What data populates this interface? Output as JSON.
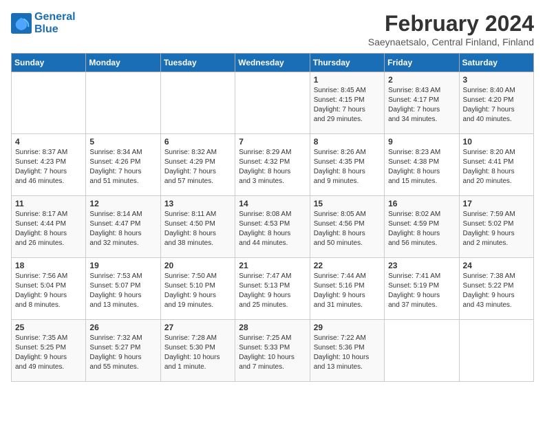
{
  "header": {
    "logo_line1": "General",
    "logo_line2": "Blue",
    "month_year": "February 2024",
    "location": "Saeynaetsalo, Central Finland, Finland"
  },
  "weekdays": [
    "Sunday",
    "Monday",
    "Tuesday",
    "Wednesday",
    "Thursday",
    "Friday",
    "Saturday"
  ],
  "weeks": [
    [
      {
        "day": "",
        "text": ""
      },
      {
        "day": "",
        "text": ""
      },
      {
        "day": "",
        "text": ""
      },
      {
        "day": "",
        "text": ""
      },
      {
        "day": "1",
        "text": "Sunrise: 8:45 AM\nSunset: 4:15 PM\nDaylight: 7 hours\nand 29 minutes."
      },
      {
        "day": "2",
        "text": "Sunrise: 8:43 AM\nSunset: 4:17 PM\nDaylight: 7 hours\nand 34 minutes."
      },
      {
        "day": "3",
        "text": "Sunrise: 8:40 AM\nSunset: 4:20 PM\nDaylight: 7 hours\nand 40 minutes."
      }
    ],
    [
      {
        "day": "4",
        "text": "Sunrise: 8:37 AM\nSunset: 4:23 PM\nDaylight: 7 hours\nand 46 minutes."
      },
      {
        "day": "5",
        "text": "Sunrise: 8:34 AM\nSunset: 4:26 PM\nDaylight: 7 hours\nand 51 minutes."
      },
      {
        "day": "6",
        "text": "Sunrise: 8:32 AM\nSunset: 4:29 PM\nDaylight: 7 hours\nand 57 minutes."
      },
      {
        "day": "7",
        "text": "Sunrise: 8:29 AM\nSunset: 4:32 PM\nDaylight: 8 hours\nand 3 minutes."
      },
      {
        "day": "8",
        "text": "Sunrise: 8:26 AM\nSunset: 4:35 PM\nDaylight: 8 hours\nand 9 minutes."
      },
      {
        "day": "9",
        "text": "Sunrise: 8:23 AM\nSunset: 4:38 PM\nDaylight: 8 hours\nand 15 minutes."
      },
      {
        "day": "10",
        "text": "Sunrise: 8:20 AM\nSunset: 4:41 PM\nDaylight: 8 hours\nand 20 minutes."
      }
    ],
    [
      {
        "day": "11",
        "text": "Sunrise: 8:17 AM\nSunset: 4:44 PM\nDaylight: 8 hours\nand 26 minutes."
      },
      {
        "day": "12",
        "text": "Sunrise: 8:14 AM\nSunset: 4:47 PM\nDaylight: 8 hours\nand 32 minutes."
      },
      {
        "day": "13",
        "text": "Sunrise: 8:11 AM\nSunset: 4:50 PM\nDaylight: 8 hours\nand 38 minutes."
      },
      {
        "day": "14",
        "text": "Sunrise: 8:08 AM\nSunset: 4:53 PM\nDaylight: 8 hours\nand 44 minutes."
      },
      {
        "day": "15",
        "text": "Sunrise: 8:05 AM\nSunset: 4:56 PM\nDaylight: 8 hours\nand 50 minutes."
      },
      {
        "day": "16",
        "text": "Sunrise: 8:02 AM\nSunset: 4:59 PM\nDaylight: 8 hours\nand 56 minutes."
      },
      {
        "day": "17",
        "text": "Sunrise: 7:59 AM\nSunset: 5:02 PM\nDaylight: 9 hours\nand 2 minutes."
      }
    ],
    [
      {
        "day": "18",
        "text": "Sunrise: 7:56 AM\nSunset: 5:04 PM\nDaylight: 9 hours\nand 8 minutes."
      },
      {
        "day": "19",
        "text": "Sunrise: 7:53 AM\nSunset: 5:07 PM\nDaylight: 9 hours\nand 13 minutes."
      },
      {
        "day": "20",
        "text": "Sunrise: 7:50 AM\nSunset: 5:10 PM\nDaylight: 9 hours\nand 19 minutes."
      },
      {
        "day": "21",
        "text": "Sunrise: 7:47 AM\nSunset: 5:13 PM\nDaylight: 9 hours\nand 25 minutes."
      },
      {
        "day": "22",
        "text": "Sunrise: 7:44 AM\nSunset: 5:16 PM\nDaylight: 9 hours\nand 31 minutes."
      },
      {
        "day": "23",
        "text": "Sunrise: 7:41 AM\nSunset: 5:19 PM\nDaylight: 9 hours\nand 37 minutes."
      },
      {
        "day": "24",
        "text": "Sunrise: 7:38 AM\nSunset: 5:22 PM\nDaylight: 9 hours\nand 43 minutes."
      }
    ],
    [
      {
        "day": "25",
        "text": "Sunrise: 7:35 AM\nSunset: 5:25 PM\nDaylight: 9 hours\nand 49 minutes."
      },
      {
        "day": "26",
        "text": "Sunrise: 7:32 AM\nSunset: 5:27 PM\nDaylight: 9 hours\nand 55 minutes."
      },
      {
        "day": "27",
        "text": "Sunrise: 7:28 AM\nSunset: 5:30 PM\nDaylight: 10 hours\nand 1 minute."
      },
      {
        "day": "28",
        "text": "Sunrise: 7:25 AM\nSunset: 5:33 PM\nDaylight: 10 hours\nand 7 minutes."
      },
      {
        "day": "29",
        "text": "Sunrise: 7:22 AM\nSunset: 5:36 PM\nDaylight: 10 hours\nand 13 minutes."
      },
      {
        "day": "",
        "text": ""
      },
      {
        "day": "",
        "text": ""
      }
    ]
  ]
}
